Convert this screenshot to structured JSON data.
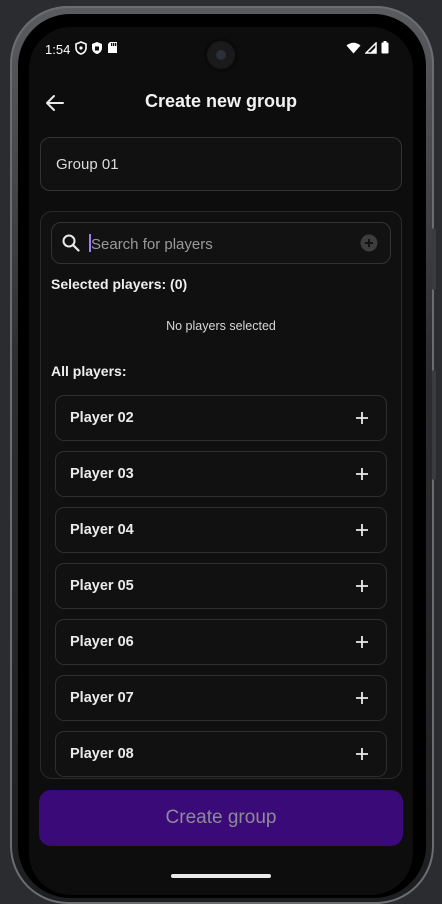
{
  "status": {
    "time": "1:54",
    "left_icons": [
      "location-shield-icon",
      "vpn-shield-icon",
      "sd-card-icon"
    ],
    "right_icons": [
      "wifi-icon",
      "signal-icon",
      "battery-icon"
    ]
  },
  "header": {
    "title": "Create new group",
    "back_icon": "arrow-left-icon"
  },
  "group_name": {
    "value": "Group 01"
  },
  "search": {
    "placeholder": "Search for players"
  },
  "selected": {
    "label": "Selected players: (0)",
    "empty_text": "No players selected"
  },
  "all": {
    "label": "All players:",
    "players": [
      {
        "name": "Player 02"
      },
      {
        "name": "Player 03"
      },
      {
        "name": "Player 04"
      },
      {
        "name": "Player 05"
      },
      {
        "name": "Player 06"
      },
      {
        "name": "Player 07"
      },
      {
        "name": "Player 08"
      }
    ]
  },
  "actions": {
    "create_label": "Create group"
  },
  "colors": {
    "accent_disabled": "#3a0a78",
    "background": "#0d0d0d"
  }
}
